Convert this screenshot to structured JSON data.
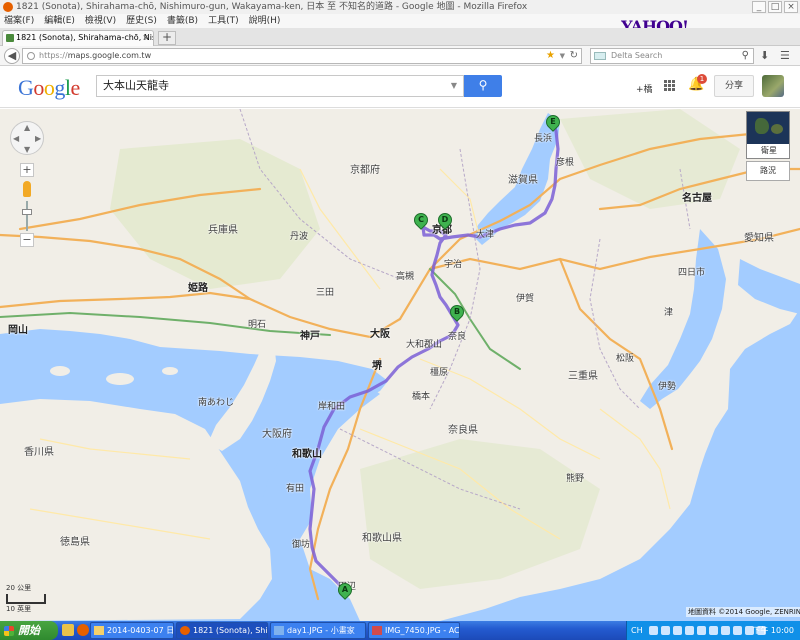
{
  "window": {
    "title": "1821 (Sonota), Shirahama-chō, Nishimuro-gun, Wakayama-ken, 日本 至 不知名的道路 - Google 地圖 - Mozilla Firefox",
    "controls": [
      "_",
      "□",
      "×"
    ]
  },
  "menu": [
    "檔案(F)",
    "編輯(E)",
    "檢視(V)",
    "歷史(S)",
    "書籤(B)",
    "工具(T)",
    "說明(H)"
  ],
  "yahoo_logo": "YAHOO!",
  "tab": {
    "label": "1821 (Sonota), Shirahama-chō, Nishimuro-g...",
    "close": "×",
    "new": "+"
  },
  "nav": {
    "url_prefix": "https://",
    "url_host": "maps.google.com.tw",
    "search_placeholder": "Delta Search"
  },
  "google": {
    "logo_letters": [
      "G",
      "o",
      "o",
      "g",
      "l",
      "e"
    ],
    "query": "大本山天龍寺",
    "plus_name": "+橋",
    "notifications": "1",
    "share": "分享"
  },
  "map": {
    "layers_label": "衛星",
    "traffic_label": "路況",
    "scale_km": "20 公里",
    "scale_mi": "10 英里",
    "attribution": "地圖資料 ©2014 Google, ZENRIN -",
    "markers": [
      "A",
      "B",
      "C",
      "D",
      "E"
    ],
    "labels": {
      "kyoto_pref": "京都府",
      "hyogo": "兵庫県",
      "shiga": "滋賀県",
      "osaka_pref": "大阪府",
      "nara": "奈良県",
      "mie": "三重県",
      "wakayama": "和歌山県",
      "tokushima": "徳島県",
      "kagawa": "香川県",
      "aichi": "愛知県",
      "osaka": "大阪",
      "kobe": "神戸",
      "himeji": "姫路",
      "kyoto": "京都",
      "nagoya": "名古屋",
      "sakai": "堺",
      "wakayama_city": "和歌山",
      "okayama": "岡山",
      "hikone": "彦根",
      "otsu": "大津",
      "nara_city": "奈良",
      "yokkaichi": "四日市",
      "tsu": "津",
      "tanabe": "田辺",
      "gobo": "御坊",
      "arida": "有田",
      "awaji": "南あわじ",
      "kishiwada": "岸和田",
      "matsusaka": "松阪",
      "ise": "伊勢",
      "kumano": "熊野",
      "hashimoto": "橋本",
      "iga": "伊賀",
      "nagahama": "長浜",
      "takatsuki": "高槻",
      "uji": "宇治",
      "kashihara": "橿原",
      "yamato": "大和郡山",
      "tamba": "丹波",
      "sanda": "三田",
      "akashi": "明石"
    }
  },
  "taskbar": {
    "start": "開始",
    "tasks": [
      "2014-0403-07 日本...",
      "1821 (Sonota), Shira...",
      "day1.JPG - 小畫家",
      "IMG_7450.JPG - ACD..."
    ],
    "lang": "CH",
    "clock": "下午 10:00"
  }
}
